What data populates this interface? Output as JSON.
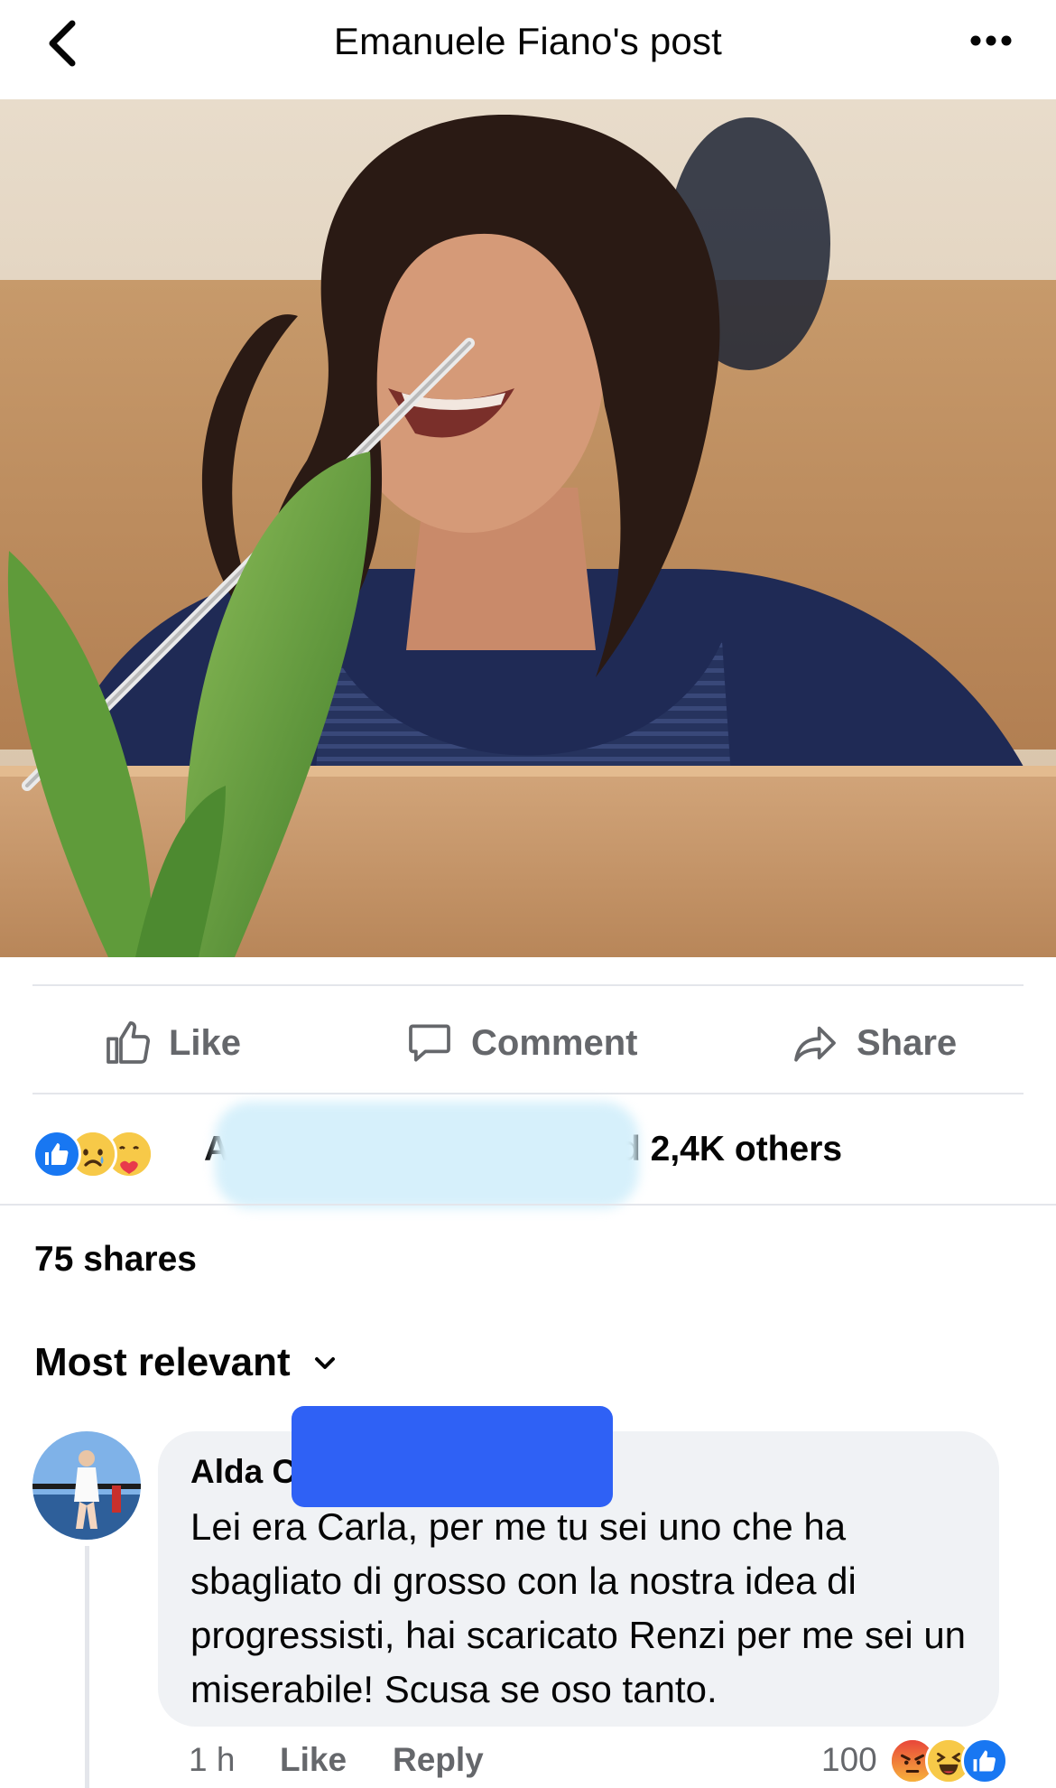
{
  "header": {
    "title": "Emanuele Fiano's post",
    "back_icon": "chevron-left-icon",
    "more_icon": "ellipsis-icon"
  },
  "post": {
    "photo_alt": "photo"
  },
  "actions": {
    "like_label": "Like",
    "comment_label": "Comment",
    "share_label": "Share"
  },
  "reactions": {
    "icons": [
      "like-reaction-icon",
      "sad-reaction-icon",
      "care-reaction-icon"
    ],
    "summary_prefix": "A",
    "summary_suffix": "nd 2,4K others"
  },
  "shares": {
    "label": "75 shares"
  },
  "comments": {
    "sort_label": "Most relevant",
    "items": [
      {
        "author": "Alda C",
        "text": "Lei era Carla, per me tu sei uno che ha sbagliato di grosso con la nostra idea di progressisti, hai scaricato Renzi per me sei un miserabile! Scusa se oso tanto.",
        "time": "1 h",
        "like_label": "Like",
        "reply_label": "Reply",
        "reaction_count": "100"
      }
    ]
  },
  "colors": {
    "accent_blue": "#1877f2",
    "meta_gray": "#65676b",
    "bubble_gray": "#f0f2f5",
    "redaction_blue": "#2f61f5",
    "redaction_light_blue": "#d6f0fb"
  }
}
